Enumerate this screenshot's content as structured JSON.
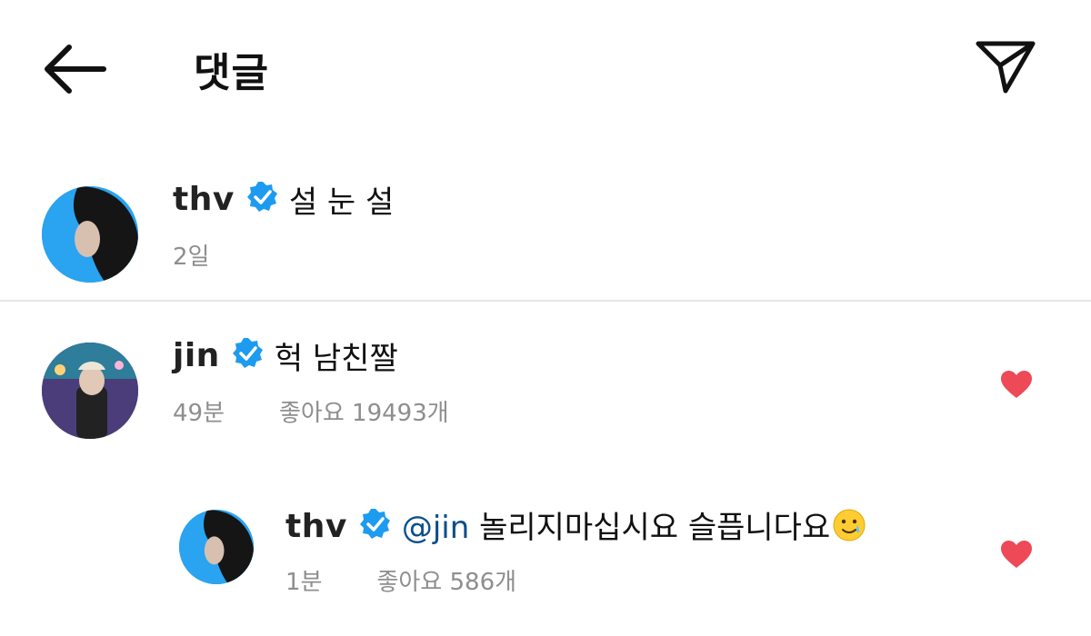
{
  "header": {
    "title": "댓글",
    "back_icon": "back-arrow-icon",
    "share_icon": "send-icon"
  },
  "comments": [
    {
      "username": "thv",
      "verified": true,
      "text": "설 눈 설",
      "time": "2일",
      "likes": ""
    },
    {
      "username": "jin",
      "verified": true,
      "text": "헉 남친짤",
      "time": "49분",
      "likes": "좋아요 19493개",
      "liked": true
    },
    {
      "username": "thv",
      "verified": true,
      "mention": "@jin",
      "text": "놀리지마십시요 슬픕니다요",
      "time": "1분",
      "likes": "좋아요 586개",
      "liked": true,
      "emoji": "smiling-face-with-tear"
    }
  ],
  "colors": {
    "verified": "#1d9bf0",
    "heart": "#ed4956",
    "meta": "#8e8e8e"
  }
}
